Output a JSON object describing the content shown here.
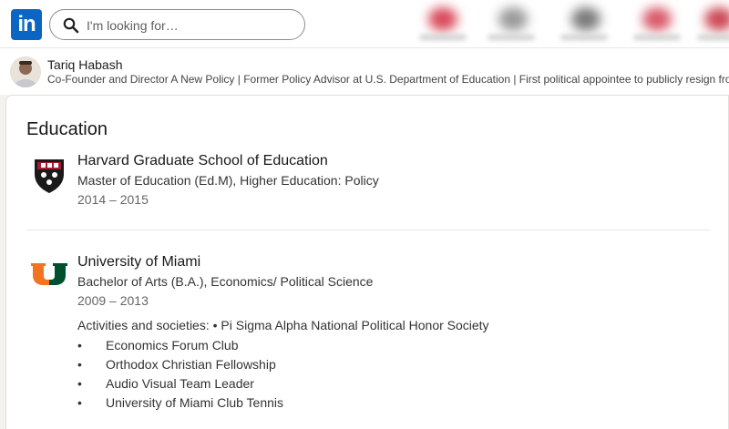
{
  "nav": {
    "logo_text": "in",
    "search_placeholder": "I'm looking for…"
  },
  "profile": {
    "name": "Tariq Habash",
    "headline": "Co-Founder and Director A New Policy | Former Policy Advisor at U.S. Department of Education | First political appointee to publicly resign fro"
  },
  "education": {
    "title": "Education",
    "entries": [
      {
        "school": "Harvard Graduate School of Education",
        "degree": "Master of Education (Ed.M), Higher Education: Policy",
        "years": "2014 – 2015"
      },
      {
        "school": "University of Miami",
        "degree": "Bachelor of Arts (B.A.), Economics/ Political Science",
        "years": "2009 – 2013",
        "activities_label": "Activities and societies: • Pi Sigma Alpha National Political Honor Society",
        "activities": [
          "Economics Forum Club",
          "Orthodox Christian Fellowship",
          "Audio Visual Team Leader",
          "University of Miami Club Tennis"
        ]
      }
    ]
  },
  "colors": {
    "brand": "#0a66c2",
    "harvard_crimson": "#a51c30",
    "miami_orange": "#f47321",
    "miami_green": "#005030"
  },
  "icons": {
    "search": "search-icon",
    "harvard_logo": "harvard-shield-logo",
    "miami_logo": "miami-u-logo"
  }
}
